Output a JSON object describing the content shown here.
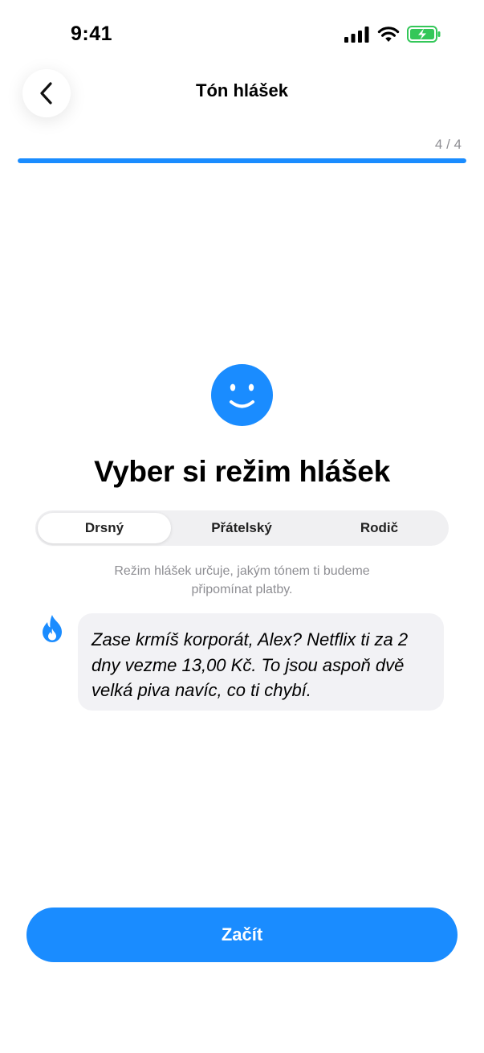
{
  "status_bar": {
    "time": "9:41",
    "icons": [
      "signal-icon",
      "wifi-icon",
      "battery-charging-icon"
    ]
  },
  "header": {
    "back_icon": "chevron-left-icon",
    "title": "Tón hlášek",
    "step": "4 / 4",
    "progress": 1.0
  },
  "main": {
    "icon": "smiley-icon",
    "title": "Vyber si režim hlášek",
    "tabs": [
      {
        "label": "Drsný",
        "selected": true
      },
      {
        "label": "Přátelský",
        "selected": false
      },
      {
        "label": "Rodič",
        "selected": false
      }
    ],
    "description": "Režim hlášek určuje, jakým tónem ti budeme připomínat platby.",
    "preview": {
      "icon": "fire-icon",
      "text": "Zase krmíš korporát, Alex? Netflix ti za 2 dny vezme 13,00 Kč. To jsou aspoň dvě velká piva navíc, co ti chybí."
    }
  },
  "footer": {
    "start_label": "Začít"
  },
  "colors": {
    "accent": "#1a8cff",
    "battery": "#34c759",
    "bubble": "#f2f2f5",
    "muted_text": "#8e8e93"
  }
}
